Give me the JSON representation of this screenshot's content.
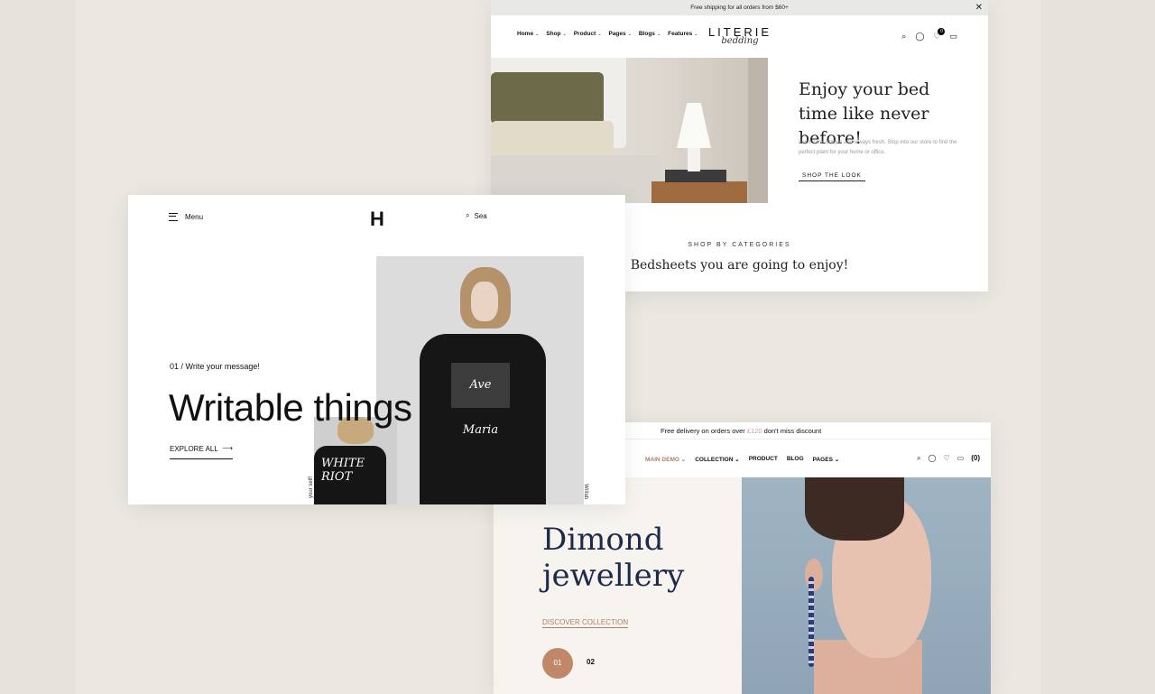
{
  "literie": {
    "topbar": "Free shipping for all orders from $60+",
    "nav": [
      "Home",
      "Shop",
      "Product",
      "Pages",
      "Blogs",
      "Features"
    ],
    "logo_main": "LITERIE",
    "logo_sub": "bedding",
    "cart_count": "0",
    "headline": "Enjoy your bed time like never before!",
    "blurb": "Lush, rare, unique and always fresh. Stop into our store to find the perfect plant for your home or office.",
    "cta": "SHOP THE LOOK",
    "categories_label": "SHOP BY CATEGORIES",
    "categories_heading": "Bedsheets you are going to enjoy!"
  },
  "writable": {
    "menu": "Menu",
    "logo": "H",
    "search": "Sea",
    "message": "01 / Write your message!",
    "title": "Writable things",
    "explore": "EXPLORE ALL",
    "shirt1": "Ave Maria",
    "shirt2": "WHITE RIOT",
    "side1": "your self!",
    "side2": "Writab"
  },
  "dimond": {
    "bar_prefix": "Free delivery on orders over ",
    "bar_amount": "£120",
    "bar_suffix": " don't miss discount",
    "nav": [
      "MAIN DEMO",
      "COLLECTION",
      "PRODUCT",
      "BLOG",
      "PAGES"
    ],
    "cart_count": "(0)",
    "headline": "Dimond jewellery",
    "cta": "DISCOVER COLLECTION",
    "slide1": "01",
    "slide2": "02"
  }
}
